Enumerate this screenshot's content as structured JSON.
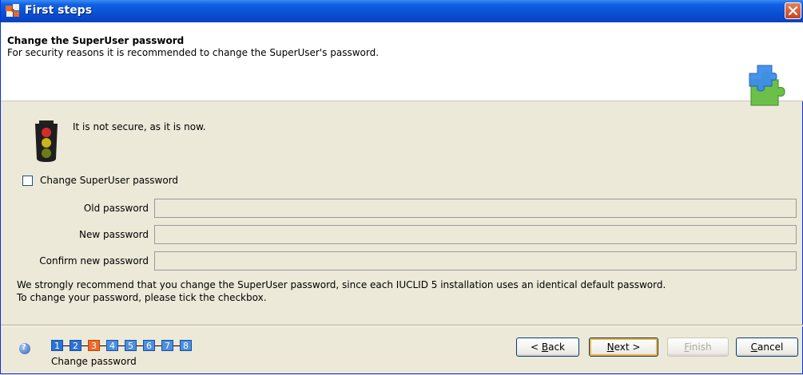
{
  "window": {
    "title": "First steps"
  },
  "header": {
    "title": "Change the SuperUser password",
    "description": "For security reasons it is recommended to change the SuperUser's password."
  },
  "status": {
    "text": "It is not secure, as it is now."
  },
  "form": {
    "checkbox_label": "Change SuperUser password",
    "checkbox_checked": false,
    "old_label": "Old password",
    "new_label": "New password",
    "confirm_label": "Confirm new password",
    "old_value": "",
    "new_value": "",
    "confirm_value": ""
  },
  "note": {
    "line1": "We strongly recommend that you change the SuperUser password, since each IUCLID 5 installation uses an identical default password.",
    "line2": "To change your password, please tick the checkbox."
  },
  "wizard": {
    "steps": [
      "1",
      "2",
      "3",
      "4",
      "5",
      "6",
      "7",
      "8"
    ],
    "current_step": "3",
    "current_caption": "Change password"
  },
  "buttons": {
    "back_mnemonic": "B",
    "back_rest": "ack",
    "back_prefix": "< ",
    "next_mnemonic": "N",
    "next_rest": "ext >",
    "finish_mnemonic": "F",
    "finish_rest": "inish",
    "cancel_mnemonic": "C",
    "cancel_rest": "ancel"
  },
  "colors": {
    "titlebar": "#0a4fd1",
    "active_step": "#ef6a28",
    "step": "#2b72d6"
  }
}
